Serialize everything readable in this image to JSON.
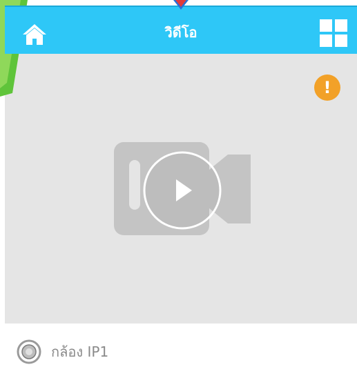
{
  "header": {
    "title": "วิดีโอ",
    "home_icon": "home-icon",
    "layout_icon": "grid-layout-icon",
    "background_color": "#2ec7f7"
  },
  "video": {
    "alert_icon": "alert-icon",
    "alert_symbol": "!",
    "alert_color": "#f2a128",
    "play_icon": "play-icon",
    "placeholder_icon": "video-camera-icon"
  },
  "camera_list": {
    "items": [
      {
        "label": "กล้อง IP1",
        "icon": "camera-lens-icon"
      }
    ]
  }
}
